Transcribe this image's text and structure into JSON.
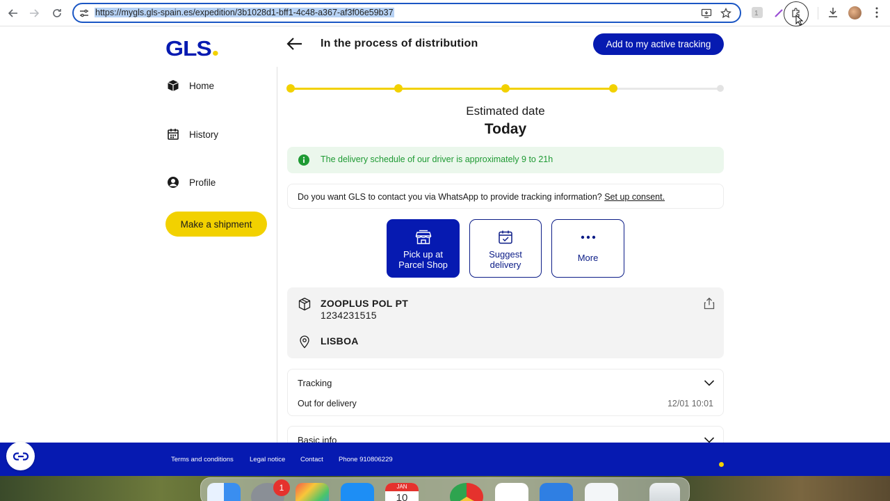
{
  "browser": {
    "url": "https://mygls.gls-spain.es/expedition/3b1028d1-bff1-4c48-a367-af3f06e59b37"
  },
  "logo": {
    "text": "GLS"
  },
  "header": {
    "title": "In the process of distribution",
    "add_tracking_label": "Add to my active tracking"
  },
  "sidebar": {
    "items": [
      {
        "label": "Home",
        "icon": "box-icon"
      },
      {
        "label": "History",
        "icon": "calendar-icon"
      },
      {
        "label": "Profile",
        "icon": "user-icon"
      }
    ],
    "make_shipment_label": "Make a shipment"
  },
  "progress": {
    "steps_total": 5,
    "steps_completed": 4
  },
  "estimate": {
    "label": "Estimated date",
    "value": "Today"
  },
  "info_banner": {
    "text": "The delivery schedule of our driver is approximately 9 to 21h"
  },
  "whatsapp": {
    "text": "Do you want GLS to contact you via WhatsApp to provide tracking information?",
    "link_label": "Set up consent."
  },
  "actions": [
    {
      "line1": "Pick up at",
      "line2": "Parcel Shop",
      "icon": "shop-icon"
    },
    {
      "line1": "Suggest",
      "line2": "delivery",
      "icon": "calendar-check-icon"
    },
    {
      "line1": "More",
      "line2": "",
      "icon": "more-dots-icon"
    }
  ],
  "parcel": {
    "sender": "ZOOPLUS POL PT",
    "tracking_number": "1234231515",
    "city": "LISBOA"
  },
  "tracking": {
    "title": "Tracking",
    "status": "Out for delivery",
    "time": "12/01 10:01"
  },
  "basic_info": {
    "title": "Basic info"
  },
  "footer": {
    "links": [
      "Terms and conditions",
      "Legal notice",
      "Contact",
      "Phone 910806229"
    ]
  },
  "dock": {
    "badge": "1",
    "calendar_month": "JAN",
    "calendar_day": "10"
  },
  "colors": {
    "brand_blue": "#061ab1",
    "brand_yellow": "#f2d100",
    "success_green": "#1e9a33"
  }
}
